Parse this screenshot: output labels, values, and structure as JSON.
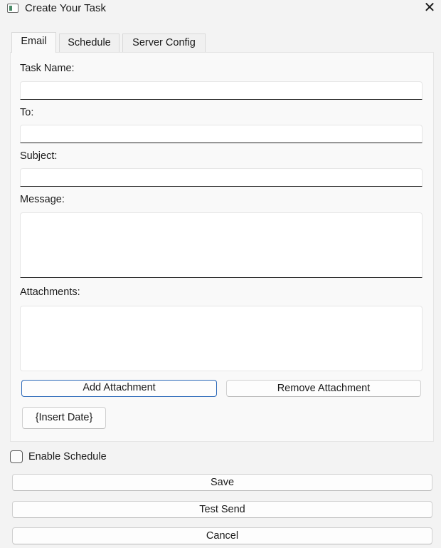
{
  "window": {
    "title": "Create Your Task",
    "close_symbol": "✕",
    "icon": "window-icon"
  },
  "tabs": [
    {
      "label": "Email",
      "active": true
    },
    {
      "label": "Schedule",
      "active": false
    },
    {
      "label": "Server Config",
      "active": false
    }
  ],
  "form": {
    "task_name": {
      "label": "Task Name:",
      "value": ""
    },
    "to": {
      "label": "To:",
      "value": ""
    },
    "subject": {
      "label": "Subject:",
      "value": ""
    },
    "message": {
      "label": "Message:",
      "value": ""
    },
    "attachments": {
      "label": "Attachments:",
      "items": []
    }
  },
  "buttons": {
    "add_attachment": "Add Attachment",
    "remove_attachment": "Remove Attachment",
    "insert_date": "{Insert Date}",
    "save": "Save",
    "test_send": "Test Send",
    "cancel": "Cancel"
  },
  "schedule": {
    "enable_label": "Enable Schedule",
    "enabled": false
  },
  "colors": {
    "window_bg": "#f3f3f3",
    "panel_bg": "#f9f9f9",
    "focus_border": "#2a68b8",
    "input_underline": "#202020"
  }
}
